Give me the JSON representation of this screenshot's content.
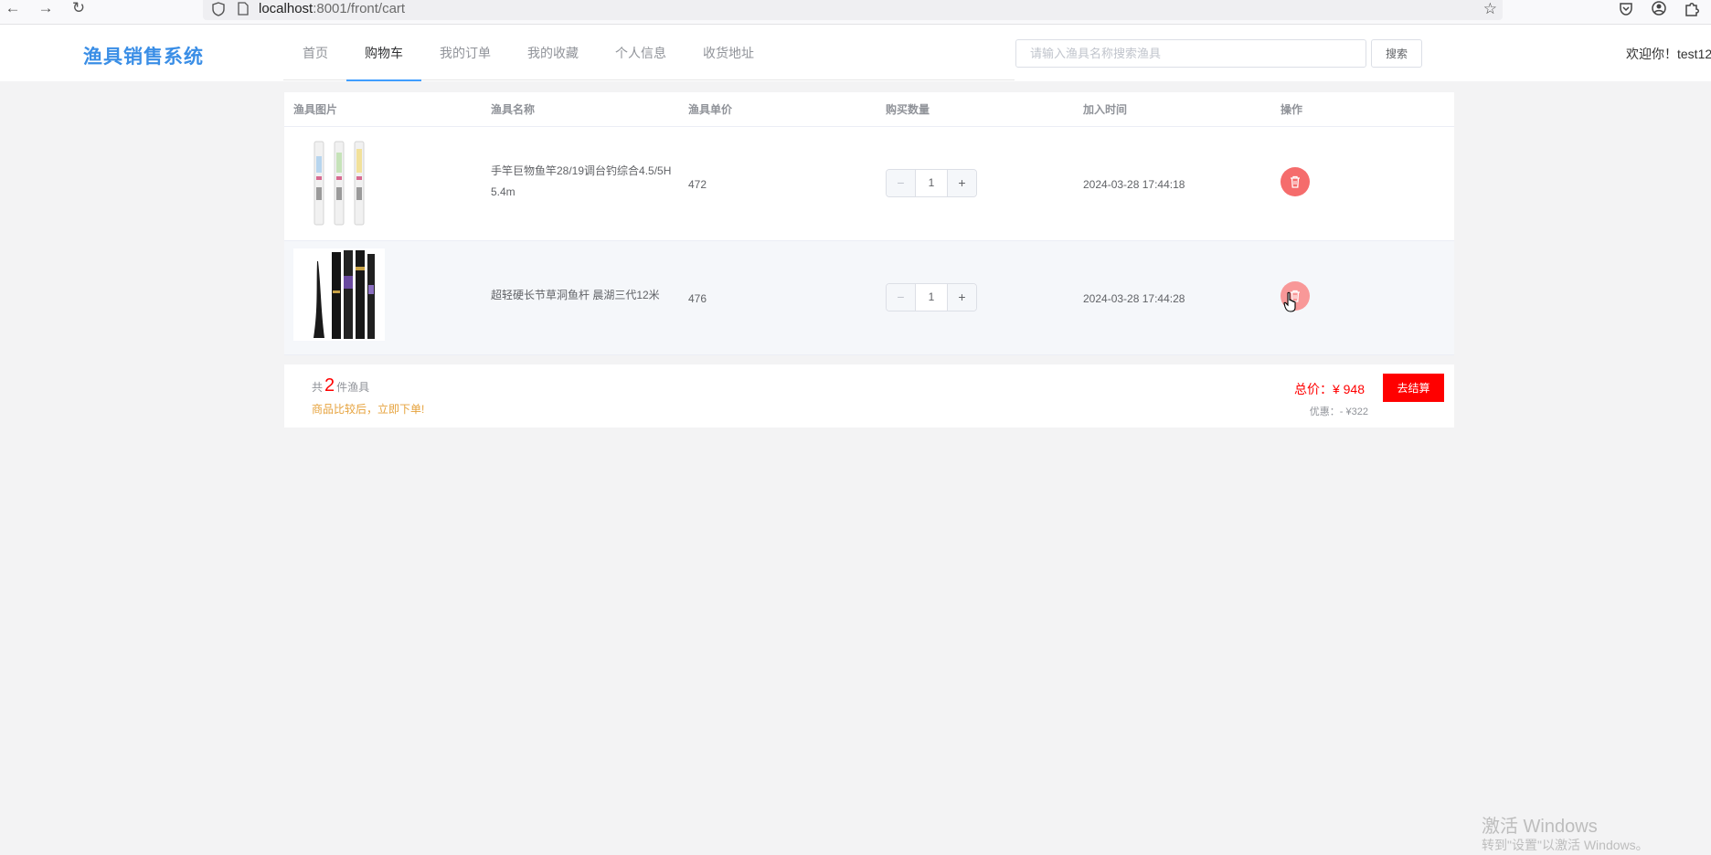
{
  "browser": {
    "url_host": "localhost",
    "url_path": ":8001/front/cart"
  },
  "header": {
    "logo": "渔具销售系统",
    "menu": [
      {
        "label": "首页"
      },
      {
        "label": "购物车"
      },
      {
        "label": "我的订单"
      },
      {
        "label": "我的收藏"
      },
      {
        "label": "个人信息"
      },
      {
        "label": "收货地址"
      }
    ],
    "active_menu": "购物车",
    "search_placeholder": "请输入渔具名称搜索渔具",
    "search_button": "搜索",
    "welcome": "欢迎你！test12"
  },
  "cart": {
    "columns": [
      "渔具图片",
      "渔具名称",
      "渔具单价",
      "购买数量",
      "加入时间",
      "操作"
    ],
    "items": [
      {
        "name": "手竿巨物鱼竿28/19调台钓综合4.5/5H 5.4m",
        "price": "472",
        "quantity": "1",
        "added_time": "2024-03-28 17:44:18"
      },
      {
        "name": "超轻硬长节草洞鱼杆 晨湖三代12米",
        "price": "476",
        "quantity": "1",
        "added_time": "2024-03-28 17:44:28"
      }
    ]
  },
  "summary": {
    "count_prefix": "共",
    "count": "2",
    "count_suffix": "件渔具",
    "tip": "商品比较后，立即下单!",
    "total_label": "总价：",
    "total_value": "¥ 948",
    "discount_label": "优惠：",
    "discount_value": "- ¥322",
    "checkout_button": "去结算"
  },
  "watermark": {
    "line1": "激活 Windows",
    "line2": "转到\"设置\"以激活 Windows。"
  }
}
